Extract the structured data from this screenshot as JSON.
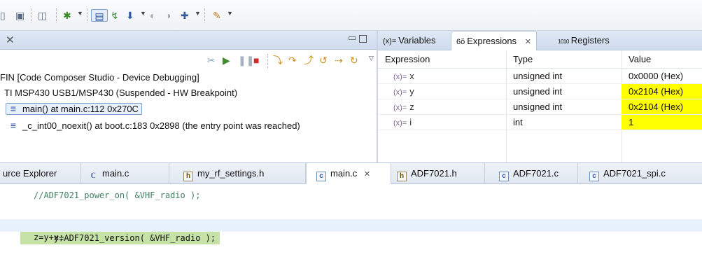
{
  "toolbar": {
    "icons": [
      "save-all-icon",
      "print-icon",
      "breakpoint-icon",
      "debug-icon",
      "terminal-icon",
      "step-filter-icon",
      "flash-icon",
      "breakpoint-set-icon",
      "clock-icon",
      "build-icon",
      "pen-icon"
    ]
  },
  "debug_view": {
    "close_glyph": "✕",
    "tree": [
      {
        "text": "FIN [Code Composer Studio - Device Debugging]"
      },
      {
        "text": "TI MSP430 USB1/MSP430 (Suspended - HW Breakpoint)"
      },
      {
        "text": "main() at main.c:112 0x270C",
        "selected": true
      },
      {
        "text": "_c_int00_noexit() at boot.c:183 0x2898  (the entry point was reached)"
      }
    ]
  },
  "expressions_view": {
    "tabs": [
      {
        "glyph": "(x)=",
        "label": "Variables"
      },
      {
        "glyph": "6ŏ",
        "label": "Expressions",
        "close": "✕",
        "active": true
      },
      {
        "glyph": "1010",
        "label": "Registers"
      }
    ],
    "columns": [
      "Expression",
      "Type",
      "Value"
    ],
    "rows": [
      {
        "glyph": "(x)=",
        "name": "x",
        "type": "unsigned int",
        "value": "0x0000 (Hex)",
        "changed": false
      },
      {
        "glyph": "(x)=",
        "name": "y",
        "type": "unsigned int",
        "value": "0x2104 (Hex)",
        "changed": true
      },
      {
        "glyph": "(x)=",
        "name": "z",
        "type": "unsigned int",
        "value": "0x2104 (Hex)",
        "changed": true
      },
      {
        "glyph": "(x)=",
        "name": "i",
        "type": "int",
        "value": "1",
        "changed": true
      }
    ]
  },
  "editor_tabs": [
    {
      "label": "urce Explorer",
      "icon": null
    },
    {
      "label": "main.c",
      "icon": "c"
    },
    {
      "label": "my_rf_settings.h",
      "icon": "h"
    },
    {
      "label": "main.c",
      "icon": "c",
      "active": true,
      "close": "✕"
    },
    {
      "label": "ADF7021.h",
      "icon": "h"
    },
    {
      "label": "ADF7021.c",
      "icon": "c"
    },
    {
      "label": "ADF7021_spi.c",
      "icon": "c"
    }
  ],
  "editor": {
    "lines": [
      "//ADF7021_power_on( &VHF_radio );",
      "",
      "y=ADF7021_version( &VHF_radio );",
      "z=y+x;"
    ]
  },
  "colors": {
    "changed_value_bg": "#ffff00",
    "current_line_bg": "#c6e2a6",
    "comment": "#3f7f5f"
  }
}
